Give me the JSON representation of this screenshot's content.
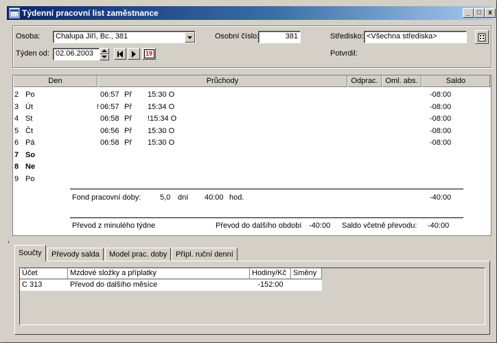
{
  "window": {
    "title": "Týdenní pracovní list zaměstnance",
    "controls": {
      "minimize": "_",
      "maximize": "□",
      "close": "x"
    }
  },
  "header": {
    "osoba_label": "Osoba:",
    "osoba_value": "Chalupa Jiří, Bc., 381",
    "osobni_cislo_label": "Osobní číslo:",
    "osobni_cislo_value": "381",
    "stredisko_label": "Středisko:",
    "stredisko_value": "<Všechna střediska>",
    "tyden_od_label": "Týden od:",
    "tyden_od_value": "02.06.2003",
    "potvrdil_label": "Potvrdil:",
    "calendar_icon_text": "19"
  },
  "grid": {
    "columns": [
      "Den",
      "Průchody",
      "Odprac.",
      "Oml. abs.",
      "Saldo"
    ],
    "rows": [
      {
        "num": "2",
        "day": "Po",
        "bold": false,
        "mark": "",
        "in": "06:57",
        "code": "Př",
        "out": "15:30 O",
        "saldo": "-08:00"
      },
      {
        "num": "3",
        "day": "Út",
        "bold": false,
        "mark": "!",
        "in": "06:57",
        "code": "Př",
        "out": "15:34 O",
        "saldo": "-08:00"
      },
      {
        "num": "4",
        "day": "St",
        "bold": false,
        "mark": "",
        "in": "06:58",
        "code": "Př",
        "out": "!15:34 O",
        "saldo": "-08:00"
      },
      {
        "num": "5",
        "day": "Čt",
        "bold": false,
        "mark": "",
        "in": "06:56",
        "code": "Př",
        "out": "15:30 O",
        "saldo": "-08:00"
      },
      {
        "num": "6",
        "day": "Pá",
        "bold": false,
        "mark": "",
        "in": "06:58",
        "code": "Př",
        "out": "15:30 O",
        "saldo": "-08:00"
      },
      {
        "num": "7",
        "day": "So",
        "bold": true,
        "mark": "",
        "in": "",
        "code": "",
        "out": "",
        "saldo": ""
      },
      {
        "num": "8",
        "day": "Ne",
        "bold": true,
        "mark": "",
        "in": "",
        "code": "",
        "out": "",
        "saldo": ""
      },
      {
        "num": "9",
        "day": "Po",
        "bold": false,
        "mark": "",
        "in": "",
        "code": "",
        "out": "",
        "saldo": ""
      }
    ],
    "fond_label": "Fond pracovní doby:",
    "fond_days": "5,0",
    "fond_days_unit": "dní",
    "fond_hours": "40:00",
    "fond_hours_unit": "hod.",
    "fond_saldo": "-40:00",
    "prevod_z_label": "Převod z minulého týdne",
    "prevod_do_label": "Převod do dalšího období",
    "prevod_do_value": "-40:00",
    "saldo_vcetne_label": "Saldo včetně převodu:",
    "saldo_vcetne_value": "-40:00"
  },
  "stray_mark": ",",
  "tabs": [
    "Součty",
    "Převody salda",
    "Model prac. doby",
    "Přípl. ruční denní"
  ],
  "totals": {
    "columns": [
      "Účet",
      "Mzdové složky a příplatky",
      "Hodiny/Kč",
      "Směny"
    ],
    "rows": [
      {
        "account": "C 313",
        "item": "Převod do dalšího měsíce",
        "hours": "-152:00",
        "shifts": ""
      }
    ]
  }
}
